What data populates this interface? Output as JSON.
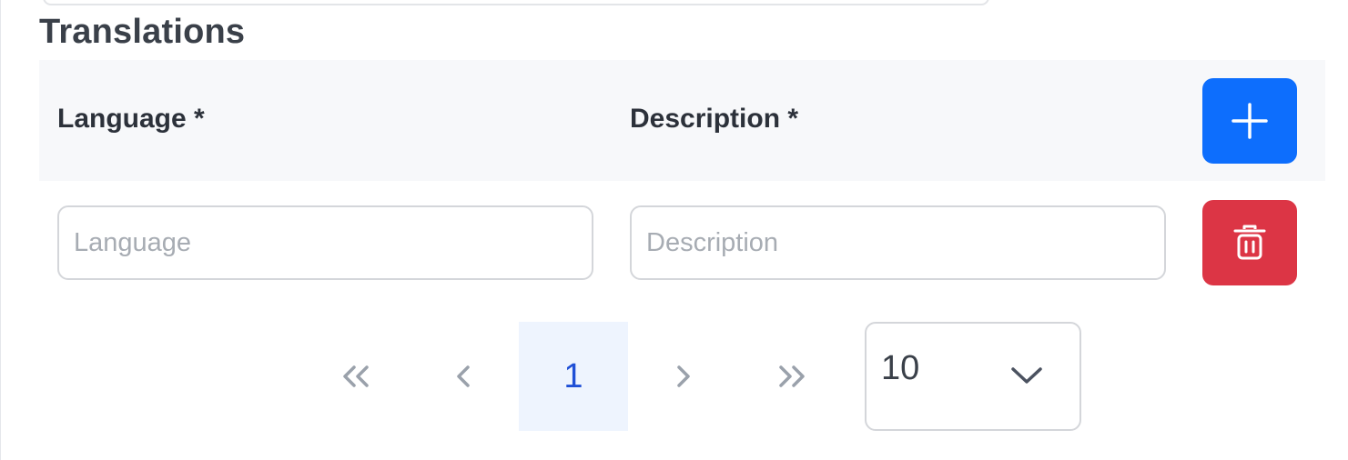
{
  "section": {
    "title": "Translations"
  },
  "table": {
    "columns": [
      {
        "label": "Language *"
      },
      {
        "label": "Description *"
      }
    ],
    "add_button": {
      "icon": "plus-icon",
      "color": "#0d6efd"
    },
    "rows": [
      {
        "language": {
          "value": "",
          "placeholder": "Language"
        },
        "description": {
          "value": "",
          "placeholder": "Description"
        },
        "delete_button": {
          "icon": "trash-icon",
          "color": "#dc3545"
        }
      }
    ]
  },
  "pagination": {
    "first_icon": "double-chevron-left-icon",
    "prev_icon": "chevron-left-icon",
    "current_page": "1",
    "next_icon": "chevron-right-icon",
    "last_icon": "double-chevron-right-icon",
    "page_size": "10",
    "page_size_icon": "chevron-down-icon",
    "active_color": "#1f4fd6"
  }
}
